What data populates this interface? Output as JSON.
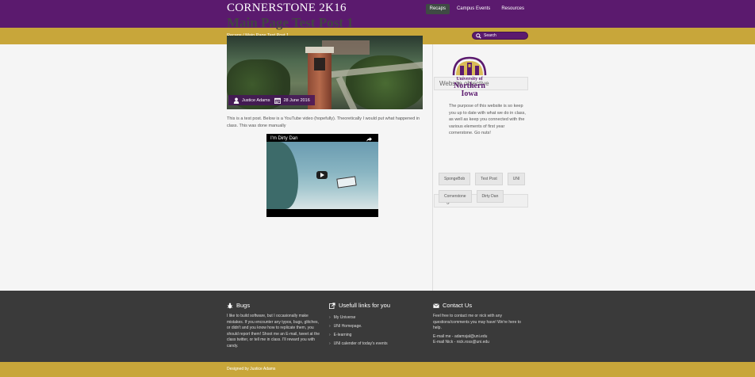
{
  "header": {
    "site_title": "CORNERSTONE 2K16",
    "nav": [
      {
        "label": "Recaps",
        "active": true
      },
      {
        "label": "Campus Events",
        "active": false
      },
      {
        "label": "Resources",
        "active": false
      }
    ]
  },
  "subbar": {
    "breadcrumb": "Recaps / Main Page Test Post 1",
    "search_placeholder": "Search"
  },
  "post": {
    "title": "Main Page Test Post 1",
    "author": "Justice Adams",
    "date": "28 June 2016",
    "body": "This is a test post. Below is a YouTube video (hopefully). Theoretically I would put what happened in class. This was done manually",
    "video_title": "I'm Dirty Dan"
  },
  "sidebar": {
    "objective_title": "Website objective",
    "logo_text": [
      "University of",
      "Northern",
      "Iowa"
    ],
    "objective_text": "The purpose of this website is so keep you up to date with what we do in class, as well as keep you connected with the various elements of first year cornerstone. Go nuts!",
    "tags_title": "Tags",
    "tags": [
      "SpongeBob",
      "Test Post",
      "UNI",
      "Cornerstone",
      "Dirty Dan"
    ]
  },
  "footer": {
    "bugs_title": "Bugs",
    "bugs_text": "I like to build software, but I occasionally make mistakes. If you encounter any typos, bugs, glitches, or didn't and you know how to replicate them, you should report them! Shoot me an E-mail, tweet at the class twitter, or tell me in class. I'll reward you with candy.",
    "links_title": "Usefull links for you",
    "links": [
      "My Universe",
      "UNI Homepage.",
      "E-learning",
      "UNI calender of today's events"
    ],
    "contact_title": "Contact Us",
    "contact_text": "Feel free to contact me or nick with any questions/comments you may have! We're here to help.",
    "contact_email_me": "E-mail me - adamsjal@uni.edu",
    "contact_email_nick": "E-mail Nick - nick.ross@uni.edu"
  },
  "credit": "Designed by Justice Adams",
  "colors": {
    "purple": "#5b1a6e",
    "gold": "#c8a63a",
    "footer": "#3a3a3a"
  }
}
